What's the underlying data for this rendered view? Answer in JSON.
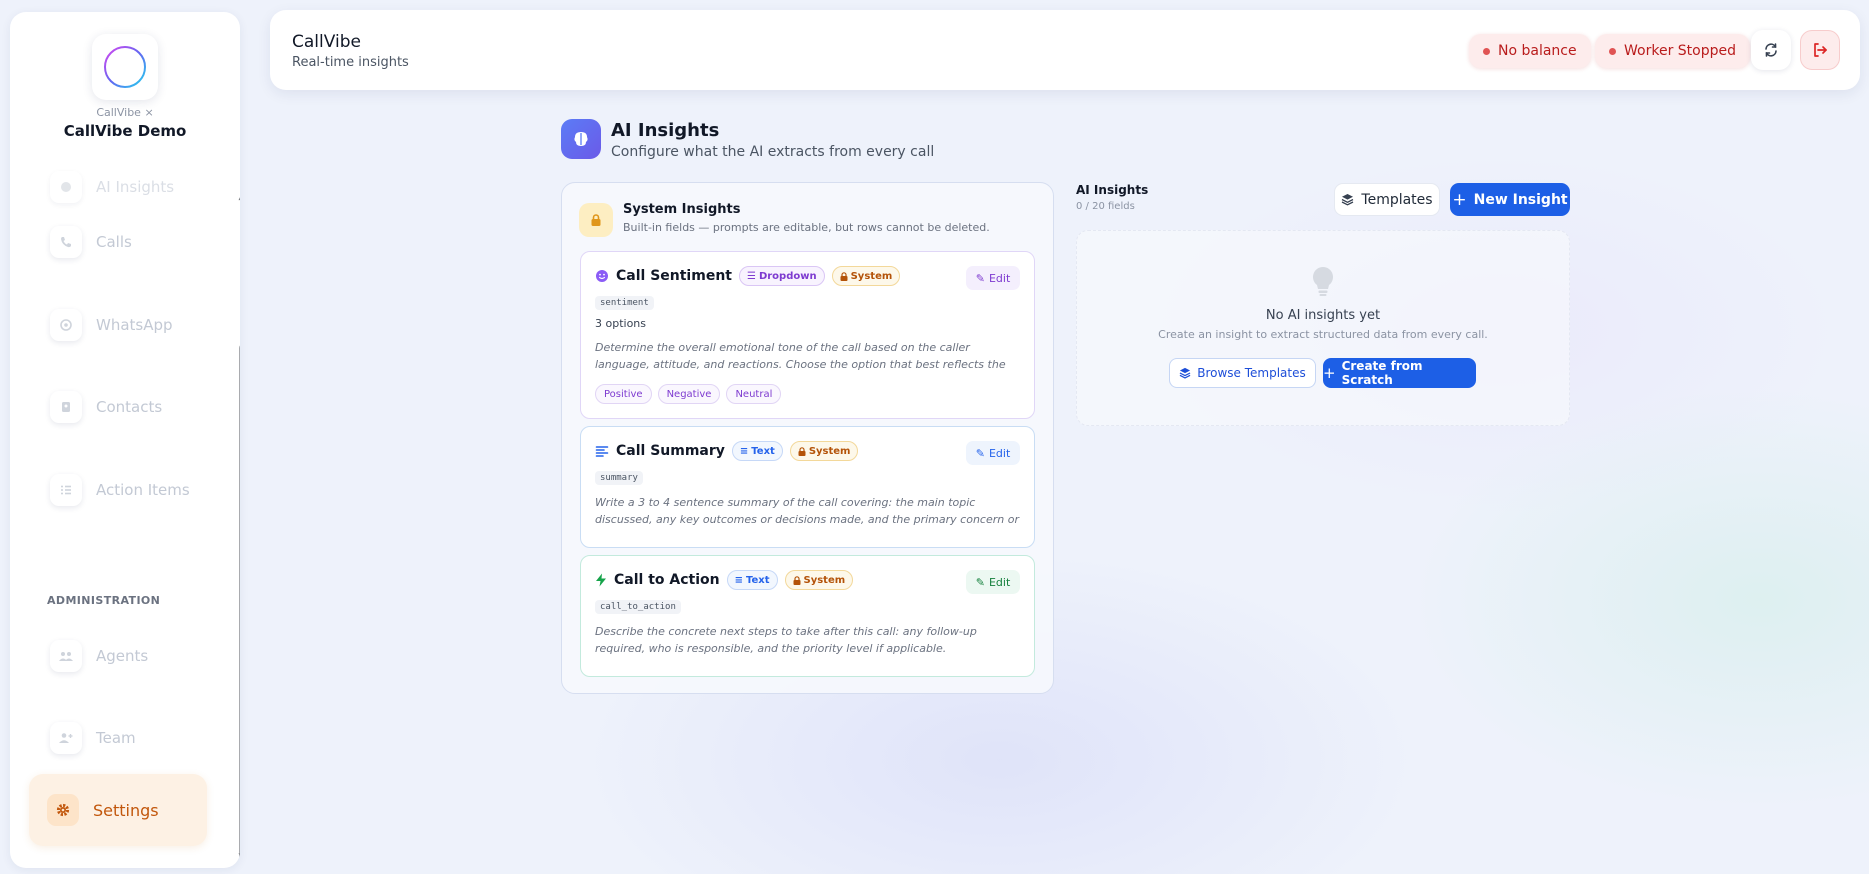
{
  "sidebar": {
    "brand_small": "CallVibe ×",
    "brand_name": "CallVibe Demo",
    "items": [
      {
        "label": "AI Insights"
      },
      {
        "label": "Calls"
      },
      {
        "label": "WhatsApp"
      },
      {
        "label": "Contacts"
      },
      {
        "label": "Action Items"
      }
    ],
    "section_admin": "ADMINISTRATION",
    "admin_items": [
      {
        "label": "Agents"
      },
      {
        "label": "Team"
      }
    ],
    "settings_label": "Settings",
    "colors": {
      "accent": "#c2570c",
      "active_bg": "#fdf1e4"
    }
  },
  "header": {
    "title": "CallVibe",
    "subtitle": "Real-time insights",
    "status_balance": "No balance",
    "status_worker": "Worker Stopped",
    "status_color": "#b91c1c",
    "icons": [
      "refresh-icon",
      "logout-icon"
    ]
  },
  "page": {
    "title": "AI Insights",
    "subtitle": "Configure what the AI extracts from every call"
  },
  "system_insights": {
    "title": "System Insights",
    "subtitle": "Built-in fields — prompts are editable, but rows cannot be deleted.",
    "cards": [
      {
        "title": "Call Sentiment",
        "type_tag": "Dropdown",
        "system_tag": "System",
        "key": "sentiment",
        "options_count": "3 options",
        "description": "Determine the overall emotional tone of the call based on the caller language, attitude, and reactions. Choose the option that best reflects the dominant…",
        "options": [
          "Positive",
          "Negative",
          "Neutral"
        ],
        "edit_label": "Edit"
      },
      {
        "title": "Call Summary",
        "type_tag": "Text",
        "system_tag": "System",
        "key": "summary",
        "description": "Write a 3 to 4 sentence summary of the call covering: the main topic discussed, any key outcomes or decisions made, and the primary concern or request of th…",
        "edit_label": "Edit"
      },
      {
        "title": "Call to Action",
        "type_tag": "Text",
        "system_tag": "System",
        "key": "call_to_action",
        "description": "Describe the concrete next steps to take after this call: any follow-up required, who is responsible, and the priority level if applicable.",
        "edit_label": "Edit"
      }
    ]
  },
  "ai_insights": {
    "title": "AI Insights",
    "count": "0 / 20 fields",
    "templates_label": "Templates",
    "new_label": "New Insight",
    "empty_title": "No AI insights yet",
    "empty_sub": "Create an insight to extract structured data from every call.",
    "browse_label": "Browse Templates",
    "scratch_label": "Create from Scratch",
    "accent": "#1d5fe6"
  }
}
